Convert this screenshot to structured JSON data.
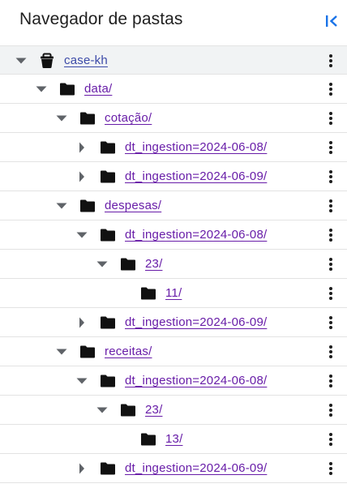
{
  "header": {
    "title": "Navegador de pastas",
    "collapse_icon": "collapse-panel-icon"
  },
  "colors": {
    "accent": "#1a73e8",
    "link": "#681da8",
    "root_link": "#3c4aa8",
    "row_border": "#e3e3e3",
    "selected_bg": "#f1f3f4"
  },
  "tree": [
    {
      "label": "case-kh",
      "depth": 0,
      "expand": "expanded",
      "icon": "bucket-icon",
      "selected": true
    },
    {
      "label": "data/",
      "depth": 1,
      "expand": "expanded",
      "icon": "folder-icon"
    },
    {
      "label": "cotação/",
      "depth": 2,
      "expand": "expanded",
      "icon": "folder-icon"
    },
    {
      "label": "dt_ingestion=2024-06-08/",
      "depth": 3,
      "expand": "collapsed",
      "icon": "folder-icon"
    },
    {
      "label": "dt_ingestion=2024-06-09/",
      "depth": 3,
      "expand": "collapsed",
      "icon": "folder-icon"
    },
    {
      "label": "despesas/",
      "depth": 2,
      "expand": "expanded",
      "icon": "folder-icon"
    },
    {
      "label": "dt_ingestion=2024-06-08/",
      "depth": 3,
      "expand": "expanded",
      "icon": "folder-icon"
    },
    {
      "label": "23/",
      "depth": 4,
      "expand": "expanded",
      "icon": "folder-icon"
    },
    {
      "label": "11/",
      "depth": 5,
      "expand": "none",
      "icon": "folder-icon"
    },
    {
      "label": "dt_ingestion=2024-06-09/",
      "depth": 3,
      "expand": "collapsed",
      "icon": "folder-icon"
    },
    {
      "label": "receitas/",
      "depth": 2,
      "expand": "expanded",
      "icon": "folder-icon"
    },
    {
      "label": "dt_ingestion=2024-06-08/",
      "depth": 3,
      "expand": "expanded",
      "icon": "folder-icon"
    },
    {
      "label": "23/",
      "depth": 4,
      "expand": "expanded",
      "icon": "folder-icon"
    },
    {
      "label": "13/",
      "depth": 5,
      "expand": "none",
      "icon": "folder-icon"
    },
    {
      "label": "dt_ingestion=2024-06-09/",
      "depth": 3,
      "expand": "collapsed",
      "icon": "folder-icon"
    }
  ]
}
